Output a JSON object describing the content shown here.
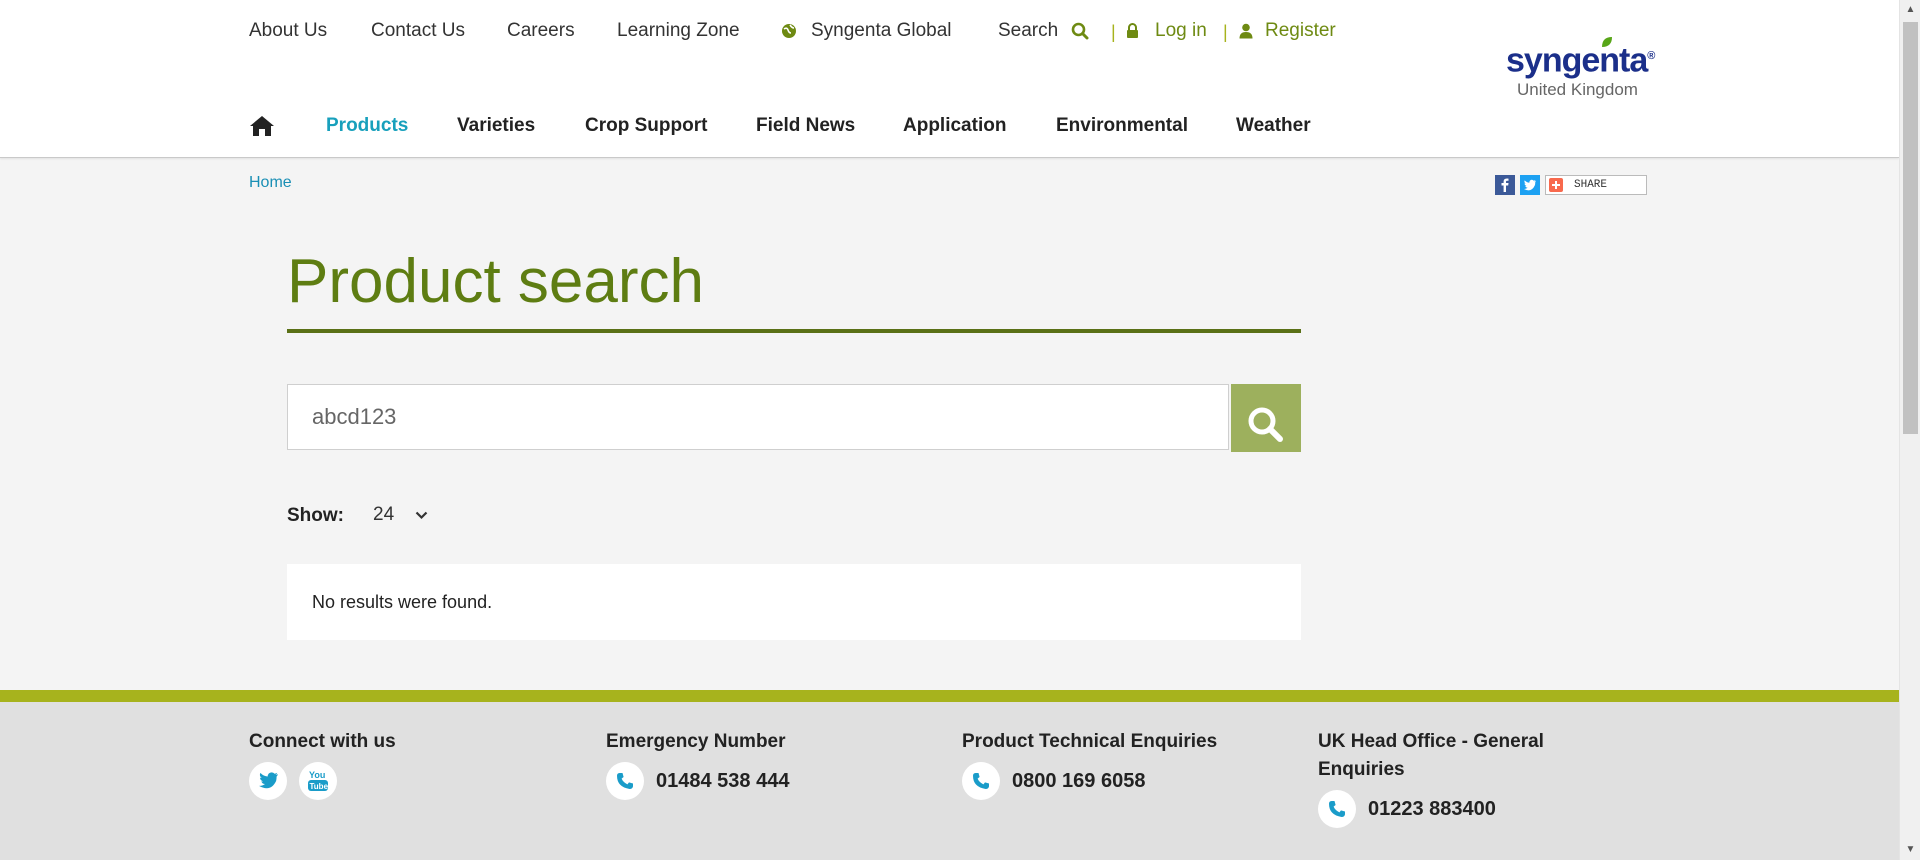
{
  "util_nav": {
    "about": "About Us",
    "contact": "Contact Us",
    "careers": "Careers",
    "learning": "Learning Zone",
    "global": "Syngenta Global",
    "search": "Search",
    "login": "Log in",
    "register": "Register"
  },
  "logo": {
    "word": "syngenta",
    "region": "United Kingdom"
  },
  "main_nav": {
    "products": "Products",
    "varieties": "Varieties",
    "crop_support": "Crop Support",
    "field_news": "Field News",
    "application": "Application",
    "environmental": "Environmental",
    "weather": "Weather"
  },
  "breadcrumb": {
    "home": "Home"
  },
  "share": {
    "label": "SHARE"
  },
  "page": {
    "title": "Product search",
    "search_value": "abcd123",
    "show_label": "Show:",
    "show_value": "24",
    "no_results": "No results were found."
  },
  "footer": {
    "connect": "Connect with us",
    "emergency": {
      "heading": "Emergency Number",
      "phone": "01484 538 444"
    },
    "technical": {
      "heading": "Product Technical Enquiries",
      "phone": "0800 169 6058"
    },
    "head_office": {
      "heading_line1": "UK Head Office - General",
      "heading_line2": "Enquiries",
      "phone": "01223 883400"
    }
  },
  "colors": {
    "brand_green": "#5e7d12",
    "accent_blue": "#18a0bc",
    "footer_strip": "#a7b31d",
    "search_button": "#9db05d"
  }
}
